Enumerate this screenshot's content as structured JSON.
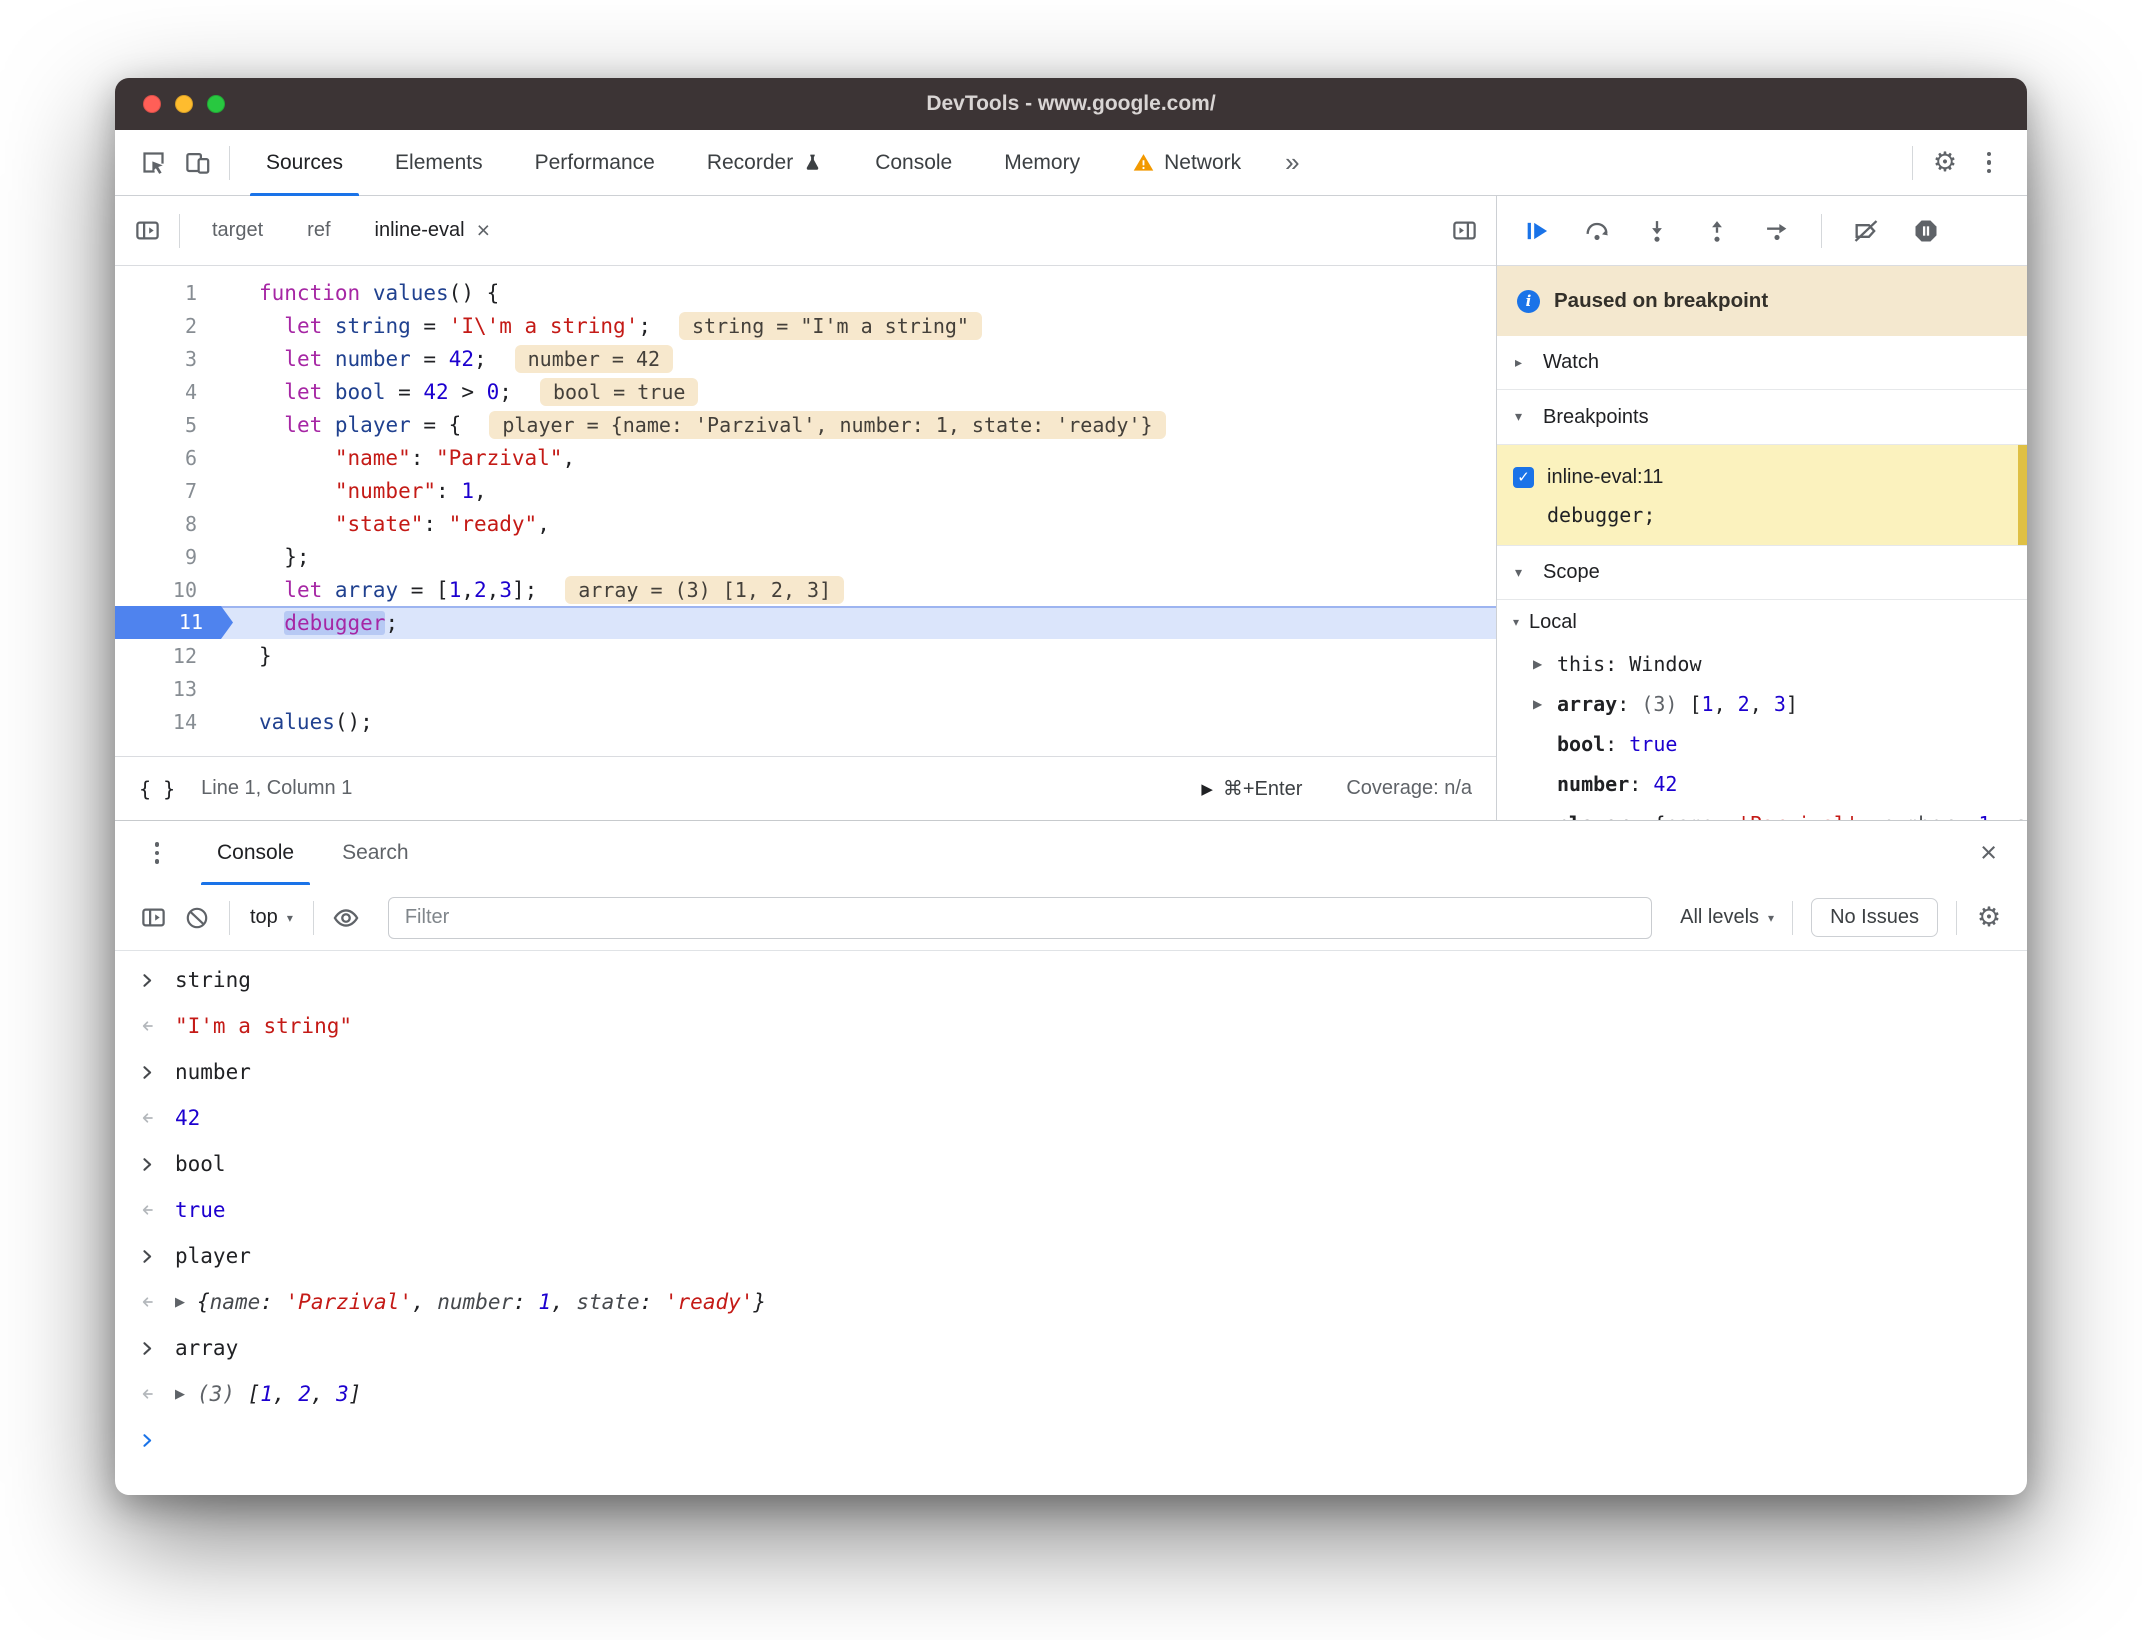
{
  "window": {
    "title": "DevTools - www.google.com/"
  },
  "icons": {
    "gear": "⚙",
    "more": "»",
    "close": "×",
    "check": "✓",
    "info": "i",
    "triangle_collapsed": "▸",
    "triangle_expanded": "▾",
    "run_triangle": "▶",
    "dropdown": "▾"
  },
  "main_toolbar": {
    "tabs": [
      {
        "label": "Sources",
        "active": true
      },
      {
        "label": "Elements"
      },
      {
        "label": "Performance"
      },
      {
        "label": "Recorder",
        "flask": true
      },
      {
        "label": "Console"
      },
      {
        "label": "Memory"
      },
      {
        "label": "Network",
        "warning": true
      }
    ],
    "more_label": "»"
  },
  "file_tabs": [
    {
      "label": "target"
    },
    {
      "label": "ref"
    },
    {
      "label": "inline-eval",
      "active": true,
      "closable": true
    }
  ],
  "editor": {
    "lines": [
      {
        "num": 1,
        "tokens": [
          [
            "kw",
            "function"
          ],
          [
            "pl",
            " "
          ],
          [
            "def",
            "values"
          ],
          [
            "pl",
            "() {"
          ]
        ]
      },
      {
        "num": 2,
        "tokens": [
          [
            "pl",
            "  "
          ],
          [
            "kw",
            "let"
          ],
          [
            "pl",
            " "
          ],
          [
            "def",
            "string"
          ],
          [
            "pl",
            " = "
          ],
          [
            "str",
            "'I\\'m a string'"
          ],
          [
            "pl",
            ";"
          ]
        ],
        "eval": "string = \"I'm a string\""
      },
      {
        "num": 3,
        "tokens": [
          [
            "pl",
            "  "
          ],
          [
            "kw",
            "let"
          ],
          [
            "pl",
            " "
          ],
          [
            "def",
            "number"
          ],
          [
            "pl",
            " = "
          ],
          [
            "num",
            "42"
          ],
          [
            "pl",
            ";"
          ]
        ],
        "eval": "number = 42"
      },
      {
        "num": 4,
        "tokens": [
          [
            "pl",
            "  "
          ],
          [
            "kw",
            "let"
          ],
          [
            "pl",
            " "
          ],
          [
            "def",
            "bool"
          ],
          [
            "pl",
            " = "
          ],
          [
            "num",
            "42"
          ],
          [
            "pl",
            " > "
          ],
          [
            "num",
            "0"
          ],
          [
            "pl",
            ";"
          ]
        ],
        "eval": "bool = true"
      },
      {
        "num": 5,
        "tokens": [
          [
            "pl",
            "  "
          ],
          [
            "kw",
            "let"
          ],
          [
            "pl",
            " "
          ],
          [
            "def",
            "player"
          ],
          [
            "pl",
            " = {"
          ]
        ],
        "eval": "player = {name: 'Parzival', number: 1, state: 'ready'}"
      },
      {
        "num": 6,
        "tokens": [
          [
            "pl",
            "      "
          ],
          [
            "str",
            "\"name\""
          ],
          [
            "pl",
            ": "
          ],
          [
            "str",
            "\"Parzival\""
          ],
          [
            "pl",
            ","
          ]
        ]
      },
      {
        "num": 7,
        "tokens": [
          [
            "pl",
            "      "
          ],
          [
            "str",
            "\"number\""
          ],
          [
            "pl",
            ": "
          ],
          [
            "num",
            "1"
          ],
          [
            "pl",
            ","
          ]
        ]
      },
      {
        "num": 8,
        "tokens": [
          [
            "pl",
            "      "
          ],
          [
            "str",
            "\"state\""
          ],
          [
            "pl",
            ": "
          ],
          [
            "str",
            "\"ready\""
          ],
          [
            "pl",
            ","
          ]
        ]
      },
      {
        "num": 9,
        "tokens": [
          [
            "pl",
            "  };"
          ]
        ]
      },
      {
        "num": 10,
        "tokens": [
          [
            "pl",
            "  "
          ],
          [
            "kw",
            "let"
          ],
          [
            "pl",
            " "
          ],
          [
            "def",
            "array"
          ],
          [
            "pl",
            " = ["
          ],
          [
            "num",
            "1"
          ],
          [
            "pl",
            ","
          ],
          [
            "num",
            "2"
          ],
          [
            "pl",
            ","
          ],
          [
            "num",
            "3"
          ],
          [
            "pl",
            "];"
          ]
        ],
        "eval": "array = (3) [1, 2, 3]"
      },
      {
        "num": 11,
        "current": true,
        "tokens": [
          [
            "pl",
            "  "
          ],
          [
            "kw-sel",
            "debugger"
          ],
          [
            "pl",
            ";"
          ]
        ]
      },
      {
        "num": 12,
        "tokens": [
          [
            "pl",
            "}"
          ]
        ]
      },
      {
        "num": 13,
        "tokens": []
      },
      {
        "num": 14,
        "tokens": [
          [
            "def",
            "values"
          ],
          [
            "pl",
            "();"
          ]
        ]
      }
    ],
    "status_bar": {
      "format_label": "{ }",
      "position": "Line 1, Column 1",
      "shortcut": "⌘+Enter",
      "coverage": "Coverage: n/a"
    }
  },
  "debugger": {
    "paused_banner": "Paused on breakpoint",
    "sections": {
      "watch": "Watch",
      "breakpoints": "Breakpoints",
      "scope": "Scope"
    },
    "breakpoint": {
      "checked": true,
      "label": "inline-eval:11",
      "code": "debugger;"
    },
    "scope": {
      "group": "Local",
      "rows": [
        {
          "expandable": true,
          "name": "this",
          "bold": false,
          "value": [
            [
              "pl",
              "Window"
            ]
          ]
        },
        {
          "expandable": true,
          "name": "array",
          "bold": true,
          "value": [
            [
              "meta",
              "(3) "
            ],
            [
              "pl",
              "["
            ],
            [
              "num",
              "1"
            ],
            [
              "pl",
              ", "
            ],
            [
              "num",
              "2"
            ],
            [
              "pl",
              ", "
            ],
            [
              "num",
              "3"
            ],
            [
              "pl",
              "]"
            ]
          ]
        },
        {
          "expandable": false,
          "name": "bool",
          "bold": true,
          "value": [
            [
              "num",
              "true"
            ]
          ]
        },
        {
          "expandable": false,
          "name": "number",
          "bold": true,
          "value": [
            [
              "num",
              "42"
            ]
          ]
        },
        {
          "expandable": true,
          "name": "player",
          "bold": true,
          "value": [
            [
              "pl",
              "{"
            ],
            [
              "key",
              "name"
            ],
            [
              "pl",
              ": "
            ],
            [
              "str",
              "'Parzival'"
            ],
            [
              "pl",
              ", "
            ],
            [
              "key",
              "number"
            ],
            [
              "pl",
              ": "
            ],
            [
              "num",
              "1"
            ],
            [
              "pl",
              ", "
            ],
            [
              "key",
              "state"
            ],
            [
              "pl",
              ": "
            ],
            [
              "str",
              "'ready'"
            ],
            [
              "pl",
              "}"
            ]
          ]
        }
      ]
    }
  },
  "console": {
    "tabs": [
      {
        "label": "Console",
        "active": true
      },
      {
        "label": "Search"
      }
    ],
    "toolbar": {
      "context_label": "top",
      "filter_placeholder": "Filter",
      "levels_label": "All levels",
      "issues_label": "No Issues"
    },
    "entries": [
      {
        "kind": "input",
        "spans": [
          [
            "pl",
            "string"
          ]
        ]
      },
      {
        "kind": "result",
        "spans": [
          [
            "str",
            "\"I'm a string\""
          ]
        ]
      },
      {
        "kind": "input",
        "spans": [
          [
            "pl",
            "number"
          ]
        ]
      },
      {
        "kind": "result",
        "spans": [
          [
            "num",
            "42"
          ]
        ]
      },
      {
        "kind": "input",
        "spans": [
          [
            "pl",
            "bool"
          ]
        ]
      },
      {
        "kind": "result",
        "spans": [
          [
            "num",
            "true"
          ]
        ]
      },
      {
        "kind": "input",
        "spans": [
          [
            "pl",
            "player"
          ]
        ]
      },
      {
        "kind": "result",
        "expandable": true,
        "italic": true,
        "spans": [
          [
            "pl",
            "{"
          ],
          [
            "key",
            "name"
          ],
          [
            "pl",
            ": "
          ],
          [
            "str",
            "'Parzival'"
          ],
          [
            "pl",
            ", "
          ],
          [
            "key",
            "number"
          ],
          [
            "pl",
            ": "
          ],
          [
            "num",
            "1"
          ],
          [
            "pl",
            ", "
          ],
          [
            "key",
            "state"
          ],
          [
            "pl",
            ": "
          ],
          [
            "str",
            "'ready'"
          ],
          [
            "pl",
            "}"
          ]
        ]
      },
      {
        "kind": "input",
        "spans": [
          [
            "pl",
            "array"
          ]
        ]
      },
      {
        "kind": "result",
        "expandable": true,
        "italic": true,
        "spans": [
          [
            "meta",
            "(3) "
          ],
          [
            "pl",
            "["
          ],
          [
            "num",
            "1"
          ],
          [
            "pl",
            ", "
          ],
          [
            "num",
            "2"
          ],
          [
            "pl",
            ", "
          ],
          [
            "num",
            "3"
          ],
          [
            "pl",
            "]"
          ]
        ]
      },
      {
        "kind": "prompt"
      }
    ]
  }
}
